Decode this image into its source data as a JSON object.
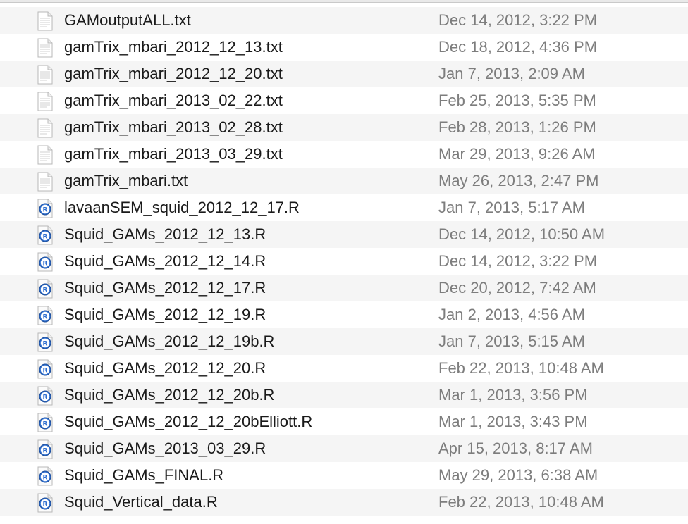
{
  "files": [
    {
      "name": "GAMoutputALL.txt",
      "date": "Dec 14, 2012, 3:22 PM",
      "icon": "text-file-icon"
    },
    {
      "name": "gamTrix_mbari_2012_12_13.txt",
      "date": "Dec 18, 2012, 4:36 PM",
      "icon": "text-file-icon"
    },
    {
      "name": "gamTrix_mbari_2012_12_20.txt",
      "date": "Jan 7, 2013, 2:09 AM",
      "icon": "text-file-icon"
    },
    {
      "name": "gamTrix_mbari_2013_02_22.txt",
      "date": "Feb 25, 2013, 5:35 PM",
      "icon": "text-file-icon"
    },
    {
      "name": "gamTrix_mbari_2013_02_28.txt",
      "date": "Feb 28, 2013, 1:26 PM",
      "icon": "text-file-icon"
    },
    {
      "name": "gamTrix_mbari_2013_03_29.txt",
      "date": "Mar 29, 2013, 9:26 AM",
      "icon": "text-file-icon"
    },
    {
      "name": "gamTrix_mbari.txt",
      "date": "May 26, 2013, 2:47 PM",
      "icon": "text-file-icon"
    },
    {
      "name": "lavaanSEM_squid_2012_12_17.R",
      "date": "Jan 7, 2013, 5:17 AM",
      "icon": "r-script-icon"
    },
    {
      "name": "Squid_GAMs_2012_12_13.R",
      "date": "Dec 14, 2012, 10:50 AM",
      "icon": "r-script-icon"
    },
    {
      "name": "Squid_GAMs_2012_12_14.R",
      "date": "Dec 14, 2012, 3:22 PM",
      "icon": "r-script-icon"
    },
    {
      "name": "Squid_GAMs_2012_12_17.R",
      "date": "Dec 20, 2012, 7:42 AM",
      "icon": "r-script-icon"
    },
    {
      "name": "Squid_GAMs_2012_12_19.R",
      "date": "Jan 2, 2013, 4:56 AM",
      "icon": "r-script-icon"
    },
    {
      "name": "Squid_GAMs_2012_12_19b.R",
      "date": "Jan 7, 2013, 5:15 AM",
      "icon": "r-script-icon"
    },
    {
      "name": "Squid_GAMs_2012_12_20.R",
      "date": "Feb 22, 2013, 10:48 AM",
      "icon": "r-script-icon"
    },
    {
      "name": "Squid_GAMs_2012_12_20b.R",
      "date": "Mar 1, 2013, 3:56 PM",
      "icon": "r-script-icon"
    },
    {
      "name": "Squid_GAMs_2012_12_20bElliott.R",
      "date": "Mar 1, 2013, 3:43 PM",
      "icon": "r-script-icon"
    },
    {
      "name": "Squid_GAMs_2013_03_29.R",
      "date": "Apr 15, 2013, 8:17 AM",
      "icon": "r-script-icon"
    },
    {
      "name": "Squid_GAMs_FINAL.R",
      "date": "May 29, 2013, 6:38 AM",
      "icon": "r-script-icon"
    },
    {
      "name": "Squid_Vertical_data.R",
      "date": "Feb 22, 2013, 10:48 AM",
      "icon": "r-script-icon"
    }
  ],
  "colors": {
    "row_stripe": "#f5f5f5",
    "name_text": "#1a1a1a",
    "date_text": "#7d7d7d",
    "r_badge": "#2f6fd0"
  }
}
